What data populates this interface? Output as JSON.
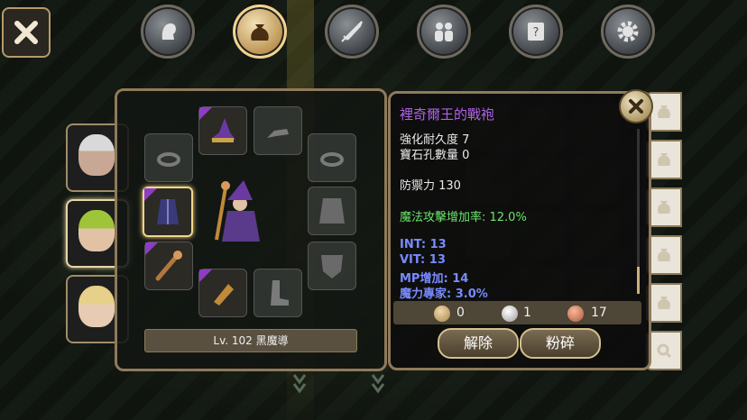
{
  "item": {
    "name": "裡奇爾王的戰袍",
    "durability": "強化耐久度 7",
    "sockets": "寶石孔數量 0",
    "defense": "防禦力 130",
    "magic_attack": "魔法攻擊增加率: 12.0%",
    "stat_int": "INT: 13",
    "stat_vit": "VIT: 13",
    "stat_mp": "MP增加: 14",
    "stat_magic_expert": "魔力專家: 3.0%"
  },
  "currency": {
    "gold": "0",
    "silver": "1",
    "bronze": "17"
  },
  "buttons": {
    "unequip": "解除",
    "shatter": "粉碎"
  },
  "character": {
    "level_class": "Lv. 102 黑魔導"
  },
  "nav_icons": [
    "character-icon",
    "bag-icon",
    "skill-icon",
    "party-icon",
    "quest-scroll-icon",
    "settings-gear-icon"
  ],
  "colors": {
    "item_name": "#b062e6",
    "bonus_green": "#6ce46c",
    "stat_blue": "#7a8aff",
    "rare_corner": "#8e3cc4",
    "selected_gold": "#f2d68a"
  }
}
